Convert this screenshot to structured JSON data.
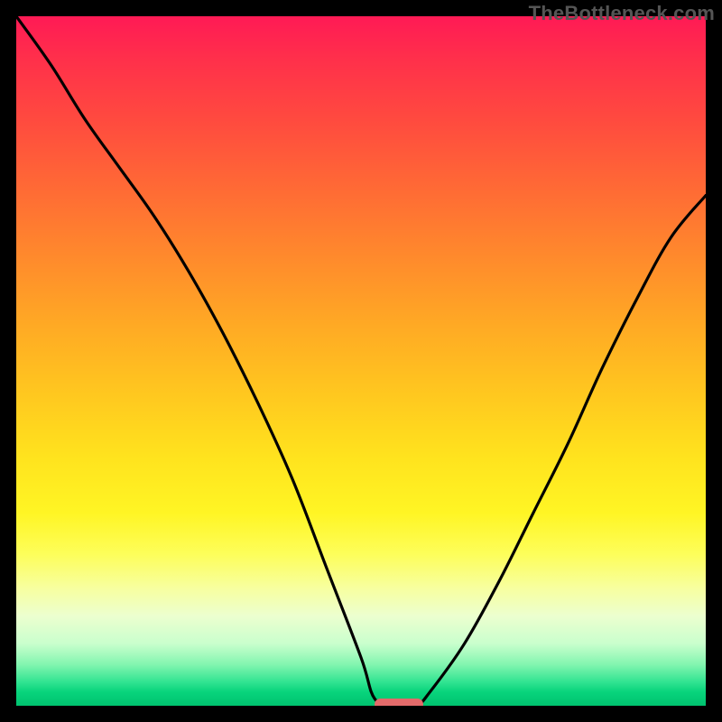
{
  "watermark": "TheBottleneck.com",
  "colors": {
    "background": "#000000",
    "gradient_top": "#ff1a55",
    "gradient_mid": "#ffe31e",
    "gradient_bottom": "#00c26f",
    "curve_stroke": "#000000",
    "pill": "#e26a6a"
  },
  "chart_data": {
    "type": "line",
    "title": "",
    "xlabel": "",
    "ylabel": "",
    "xlim": [
      0,
      100
    ],
    "ylim": [
      0,
      100
    ],
    "grid": false,
    "legend": false,
    "marker": {
      "x_start": 52,
      "x_end": 59,
      "y": 0,
      "shape": "pill"
    },
    "series": [
      {
        "name": "bottleneck-curve",
        "x": [
          0,
          5,
          10,
          15,
          20,
          25,
          30,
          35,
          40,
          45,
          50,
          52,
          55,
          58,
          60,
          65,
          70,
          75,
          80,
          85,
          90,
          95,
          100
        ],
        "y": [
          100,
          93,
          85,
          78,
          71,
          63,
          54,
          44,
          33,
          20,
          7,
          1,
          0,
          0,
          2,
          9,
          18,
          28,
          38,
          49,
          59,
          68,
          74
        ]
      }
    ]
  }
}
